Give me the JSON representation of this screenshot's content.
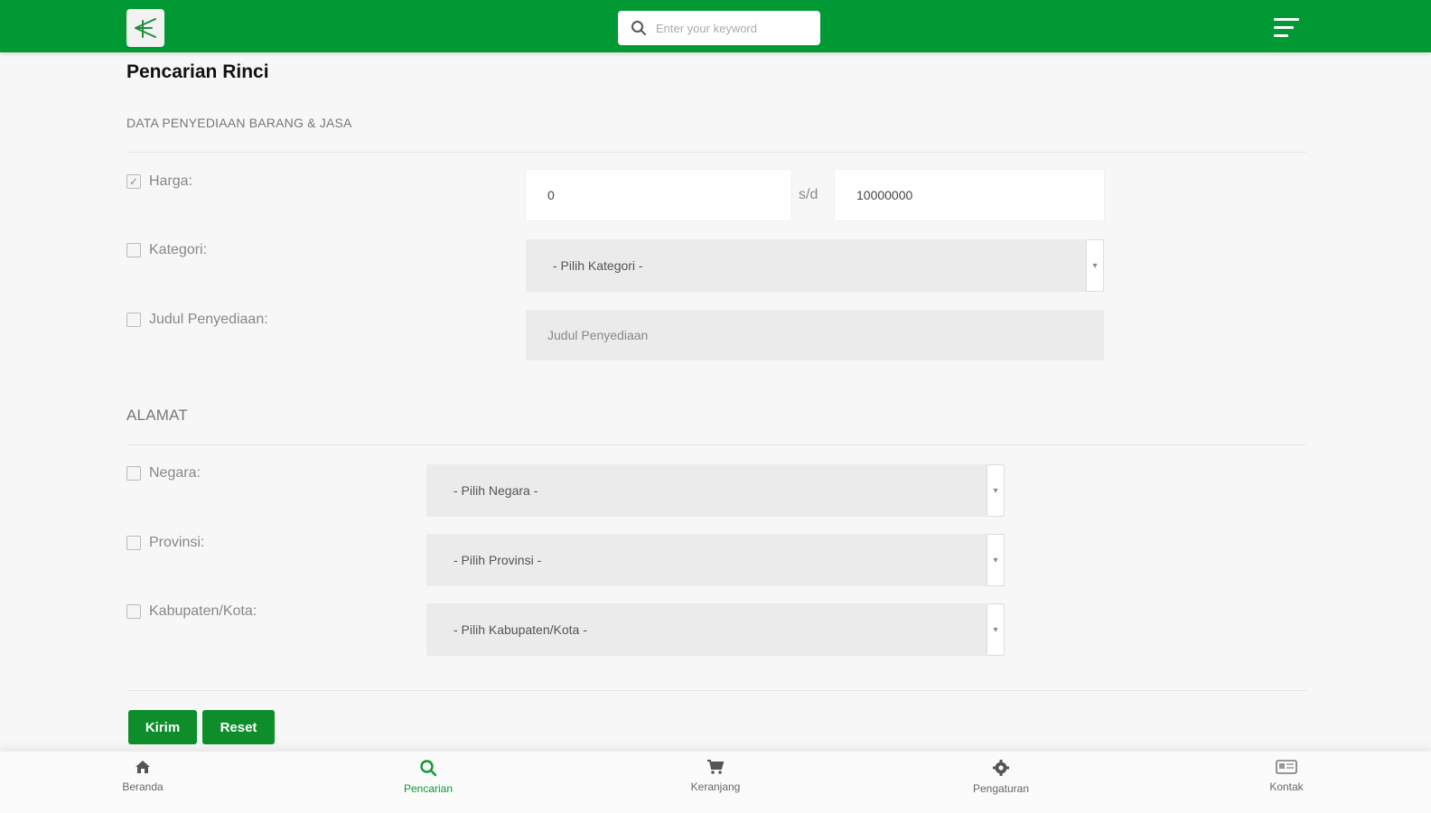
{
  "header": {
    "search_placeholder": "Enter your keyword"
  },
  "page": {
    "title": "Pencarian Rinci"
  },
  "section_goods": {
    "title": "DATA PENYEDIAAN BARANG & JASA",
    "price": {
      "label": "Harga:",
      "checked": true,
      "min_value": "0",
      "separator": "s/d",
      "max_value": "10000000"
    },
    "category": {
      "label": "Kategori:",
      "checked": false,
      "selected": "- Pilih Kategori -"
    },
    "title_field": {
      "label": "Judul Penyediaan:",
      "checked": false,
      "placeholder": "Judul Penyediaan"
    }
  },
  "section_address": {
    "title": "ALAMAT",
    "country": {
      "label": "Negara:",
      "checked": false,
      "selected": "- Pilih Negara -"
    },
    "province": {
      "label": "Provinsi:",
      "checked": false,
      "selected": "- Pilih Provinsi -"
    },
    "city": {
      "label": "Kabupaten/Kota:",
      "checked": false,
      "selected": "- Pilih Kabupaten/Kota -"
    }
  },
  "actions": {
    "submit_label": "Kirim",
    "reset_label": "Reset"
  },
  "bottom_nav": [
    {
      "label": "Beranda",
      "icon": "home-icon",
      "active": false
    },
    {
      "label": "Pencarian",
      "icon": "search-icon",
      "active": true
    },
    {
      "label": "Keranjang",
      "icon": "cart-icon",
      "active": false
    },
    {
      "label": "Pengaturan",
      "icon": "gear-icon",
      "active": false
    },
    {
      "label": "Kontak",
      "icon": "contact-card-icon",
      "active": false
    }
  ],
  "colors": {
    "brand_green": "#009933",
    "button_green": "#0d8e2b",
    "active_nav": "#0c9a32"
  }
}
